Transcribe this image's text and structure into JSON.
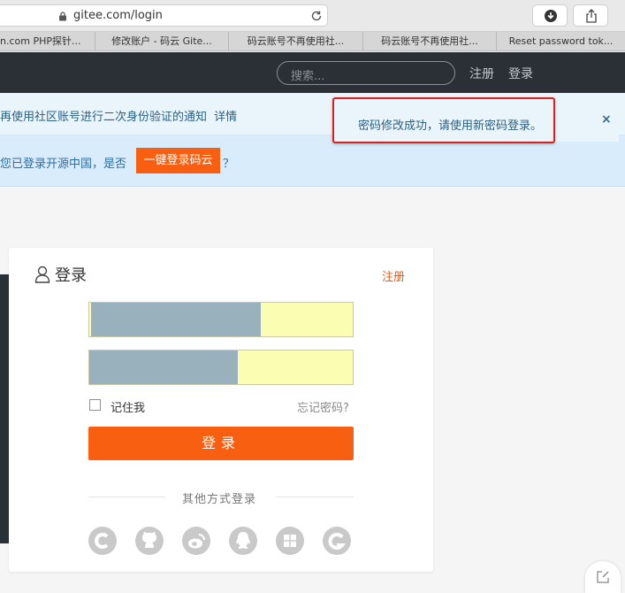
{
  "browser": {
    "url": "gitee.com/login",
    "tabs": [
      "n.com PHP探针...",
      "修改账户 - 码云 Gite...",
      "码云账号不再使用社...",
      "码云账号不再使用社...",
      "Reset password tok..."
    ]
  },
  "header": {
    "search_placeholder": "搜索...",
    "register_label": "注册",
    "login_label": "登录"
  },
  "notices": {
    "notice1_text": "再使用社区账号进行二次身份验证的通知",
    "notice1_link": "详情",
    "notice2_text": "您已登录开源中国，是否",
    "onekey_button": "一键登录码云",
    "notice2_suffix": "？"
  },
  "toast": {
    "message": "密码修改成功，请使用新密码登录。",
    "close": "×"
  },
  "login_card": {
    "title": "登录",
    "register_link": "注册",
    "remember_label": "记住我",
    "forgot_link": "忘记密码?",
    "submit_label": "登录",
    "other_methods": "其他方式登录",
    "social_icons": [
      "oschina-icon",
      "github-icon",
      "weibo-icon",
      "qq-icon",
      "windows-icon",
      "gitee-c-icon"
    ]
  },
  "colors": {
    "accent": "#f95f10",
    "header_bg": "#2b3037",
    "toast_border": "#d8211f"
  }
}
